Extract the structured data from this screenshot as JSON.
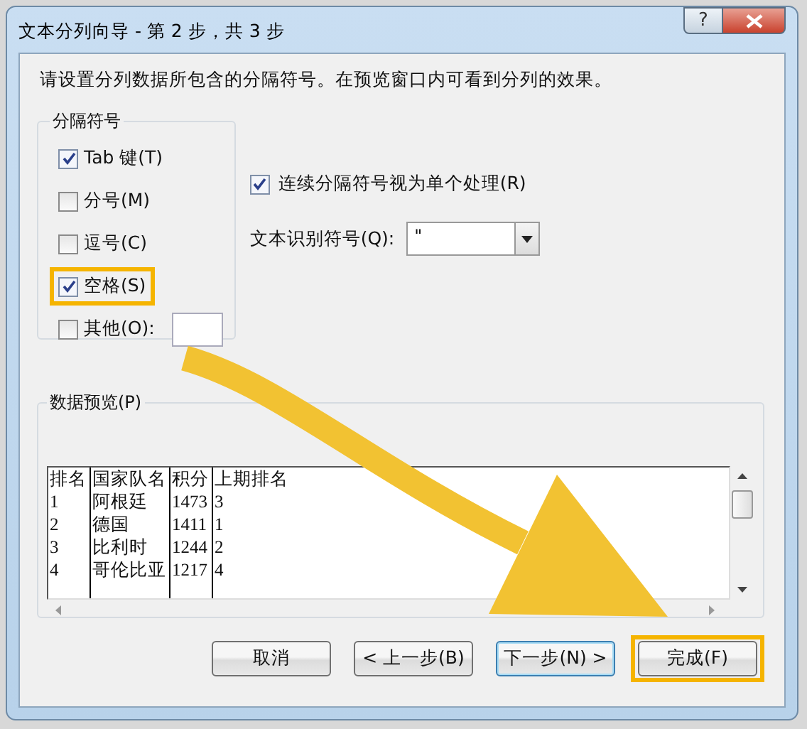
{
  "window": {
    "title": "文本分列向导 - 第 2 步，共 3 步",
    "help_button": "?"
  },
  "instruction": "请设置分列数据所包含的分隔符号。在预览窗口内可看到分列的效果。",
  "delimiters": {
    "title": "分隔符号",
    "options": [
      {
        "kind": "checkbox",
        "label": "Tab 键(T)",
        "checked": true,
        "highlighted": false
      },
      {
        "kind": "checkbox",
        "label": "分号(M)",
        "checked": false,
        "highlighted": false
      },
      {
        "kind": "checkbox",
        "label": "逗号(C)",
        "checked": false,
        "highlighted": false
      },
      {
        "kind": "checkbox",
        "label": "空格(S)",
        "checked": true,
        "highlighted": true
      },
      {
        "kind": "checkbox_with_field",
        "label": "其他(O):",
        "checked": false,
        "highlighted": false
      }
    ]
  },
  "consecutive": {
    "label": "连续分隔符号视为单个处理(R)",
    "checked": true
  },
  "text_qualifier": {
    "label": "文本识别符号(Q):",
    "value": "\""
  },
  "preview": {
    "title": "数据预览(P)",
    "rows": [
      [
        "排名",
        "国家队名",
        "积分",
        "上期排名"
      ],
      [
        "1",
        "阿根廷",
        "1473",
        "3"
      ],
      [
        "2",
        "德国",
        "1411",
        "1"
      ],
      [
        "3",
        "比利时",
        "1244",
        "2"
      ],
      [
        "4",
        "哥伦比亚",
        "1217",
        "4"
      ]
    ]
  },
  "buttons": [
    {
      "label": "取消",
      "focused": false,
      "highlighted": false
    },
    {
      "label": "< 上一步(B)",
      "focused": false,
      "highlighted": false
    },
    {
      "label": "下一步(N) >",
      "focused": true,
      "highlighted": false
    },
    {
      "label": "完成(F)",
      "focused": false,
      "highlighted": true
    }
  ]
}
